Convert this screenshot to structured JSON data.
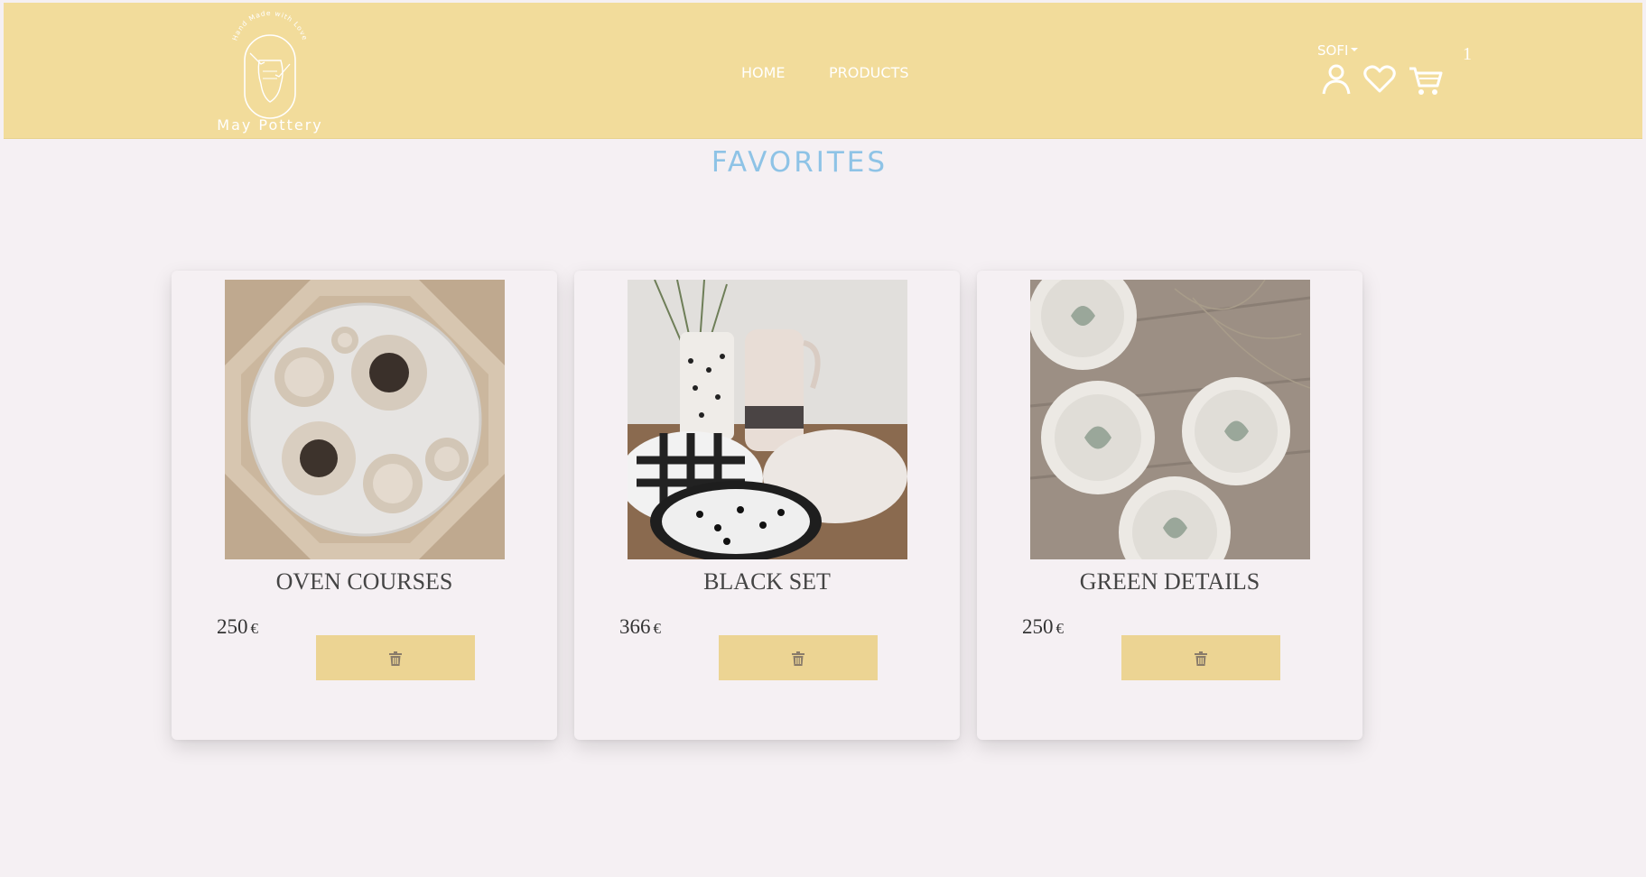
{
  "brand": {
    "arc_text": "Hand Made with Love",
    "name": "May Pottery"
  },
  "nav": {
    "home": "HOME",
    "products": "PRODUCTS"
  },
  "user": {
    "name": "SOFI"
  },
  "cart": {
    "count": "1"
  },
  "icons": {
    "user": "user-icon",
    "heart": "heart-icon",
    "cart": "cart-icon",
    "delete": "trash-icon"
  },
  "colors": {
    "header_bg": "#f2dc9b",
    "page_bg": "#f5f0f3",
    "title": "#8ec3e6",
    "button": "#ecd493"
  },
  "page": {
    "title": "FAVORITES"
  },
  "favorites": [
    {
      "name": "OVEN COURSES",
      "price": "250",
      "currency": "€"
    },
    {
      "name": "BLACK SET",
      "price": "366",
      "currency": "€"
    },
    {
      "name": "GREEN DETAILS",
      "price": "250",
      "currency": "€"
    }
  ]
}
